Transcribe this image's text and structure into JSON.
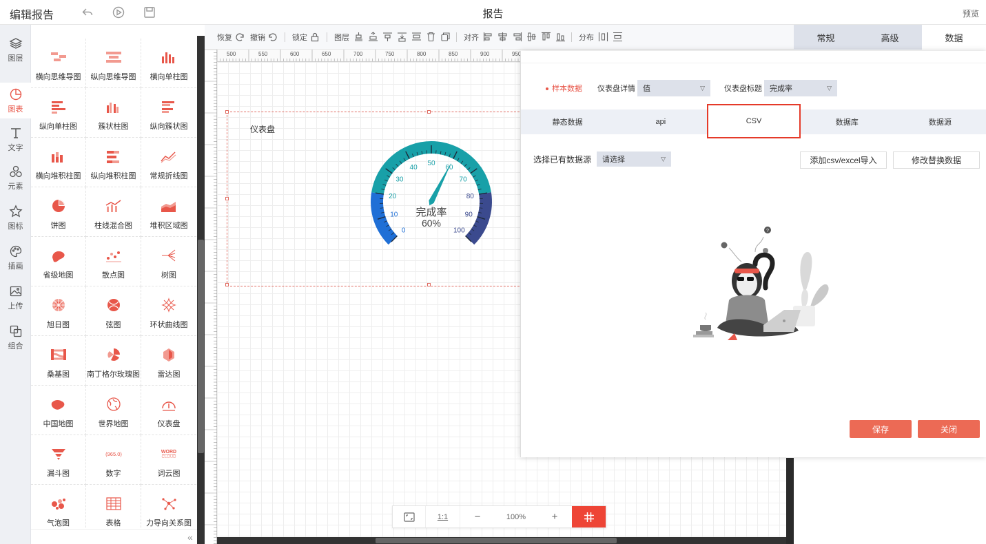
{
  "header": {
    "app_title": "编辑报告",
    "page_title": "报告",
    "preview": "预览"
  },
  "iconbar": [
    {
      "label": "图层",
      "icon": "layers-icon"
    },
    {
      "label": "图表",
      "icon": "chart-icon"
    },
    {
      "label": "文字",
      "icon": "text-icon"
    },
    {
      "label": "元素",
      "icon": "shapes-icon"
    },
    {
      "label": "图标",
      "icon": "star-icon"
    },
    {
      "label": "插画",
      "icon": "palette-icon"
    },
    {
      "label": "上传",
      "icon": "image-upload-icon"
    },
    {
      "label": "组合",
      "icon": "group-icon"
    }
  ],
  "palette": {
    "items": [
      "横向思维导图",
      "纵向思维导图",
      "横向单柱图",
      "纵向单柱图",
      "簇状柱图",
      "纵向簇状图",
      "横向堆积柱图",
      "纵向堆积柱图",
      "常规折线图",
      "饼图",
      "柱线混合图",
      "堆积区域图",
      "省级地图",
      "散点图",
      "树图",
      "旭日图",
      "弦图",
      "环状曲线图",
      "桑基图",
      "南丁格尔玫瑰图",
      "雷达图",
      "中国地图",
      "世界地图",
      "仪表盘",
      "漏斗图",
      "数字",
      "词云图",
      "气泡图",
      "表格",
      "力导向关系图"
    ],
    "number_icon": "(965.0)",
    "wordcloud_icon": [
      "WORD",
      "CLOUD"
    ]
  },
  "toolbar": {
    "redo": "恢复",
    "undo": "撤销",
    "lock": "锁定",
    "layer": "图层",
    "align": "对齐",
    "distribute": "分布"
  },
  "ruler": {
    "labels": [
      "500",
      "550",
      "600",
      "650",
      "700",
      "750",
      "800",
      "850",
      "900",
      "950"
    ]
  },
  "widget": {
    "title": "仪表盘",
    "gauge": {
      "label": "完成率",
      "value_text": "60%",
      "value": 60,
      "min": 0,
      "max": 100,
      "ticks": [
        "0",
        "10",
        "20",
        "30",
        "40",
        "50",
        "60",
        "70",
        "80",
        "90",
        "100"
      ],
      "colors": {
        "low": "#1f6fd6",
        "mid": "#18a0a8",
        "high": "#3b4a8e"
      }
    }
  },
  "zoom": {
    "ratio": "1:1",
    "minus": "−",
    "value": "100%",
    "plus": "+"
  },
  "right_tabs": [
    {
      "label": "常规"
    },
    {
      "label": "高级"
    },
    {
      "label": "数据",
      "active": true
    }
  ],
  "dialog": {
    "sample_data": "样本数据",
    "detail_label": "仪表盘详情",
    "detail_value": "值",
    "title_label": "仪表盘标题",
    "title_value": "完成率",
    "tabs": [
      {
        "label": "静态数据"
      },
      {
        "label": "api"
      },
      {
        "label": "CSV",
        "active": true
      },
      {
        "label": "数据库"
      },
      {
        "label": "数据源"
      }
    ],
    "existing_label": "选择已有数据源",
    "existing_placeholder": "请选择",
    "add_csv": "添加csv/excel导入",
    "replace": "修改替换数据",
    "save": "保存",
    "close": "关闭"
  }
}
